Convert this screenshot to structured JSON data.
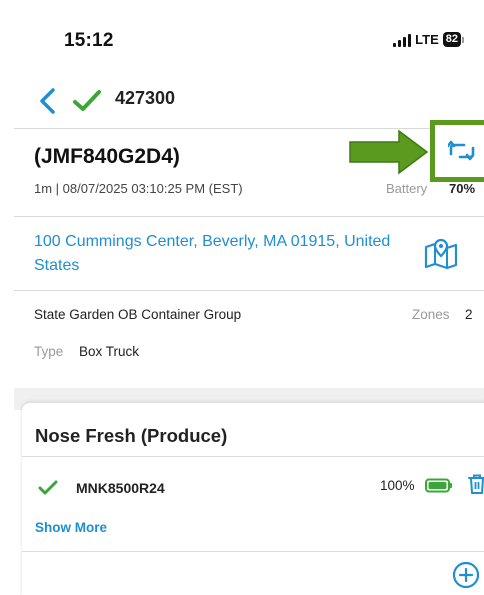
{
  "status_bar": {
    "time": "15:12",
    "network": "LTE",
    "battery": "82"
  },
  "header": {
    "title": "427300",
    "back_icon": "chevron-left-icon",
    "status_icon": "check-icon"
  },
  "device": {
    "title": "(JMF840G2D4)",
    "meta": "1m | 08/07/2025 03:10:25 PM (EST)",
    "battery_label": "Battery",
    "battery_value": "70%",
    "sync_icon": "sync-icon"
  },
  "location": {
    "address": "100 Cummings Center, Beverly, MA 01915, United States",
    "map_icon": "map-pin-icon"
  },
  "details": {
    "group": "State Garden OB Container Group",
    "zones_label": "Zones",
    "zones_value": "2",
    "type_label": "Type",
    "type_value": "Box Truck"
  },
  "card": {
    "title": "Nose Fresh (Produce)",
    "items": [
      {
        "id": "MNK8500R24",
        "battery_pct": "100%",
        "battery_level": 1.0
      }
    ],
    "show_more": "Show More"
  },
  "colors": {
    "accent_blue": "#1f8fd1",
    "check_green": "#3aa63a",
    "annotation_green": "#5a9a1f"
  }
}
